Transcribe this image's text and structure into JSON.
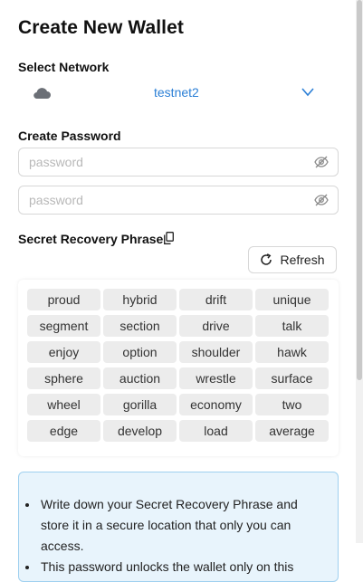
{
  "title": "Create New Wallet",
  "network": {
    "label": "Select Network",
    "selected": "testnet2",
    "icon": "cloud-icon"
  },
  "password": {
    "label": "Create Password",
    "placeholder": "password",
    "confirm_placeholder": "password"
  },
  "recovery": {
    "label": "Secret Recovery Phrase",
    "refresh_label": "Refresh",
    "words": [
      "proud",
      "hybrid",
      "drift",
      "unique",
      "segment",
      "section",
      "drive",
      "talk",
      "enjoy",
      "option",
      "shoulder",
      "hawk",
      "sphere",
      "auction",
      "wrestle",
      "surface",
      "wheel",
      "gorilla",
      "economy",
      "two",
      "edge",
      "develop",
      "load",
      "average"
    ]
  },
  "info": {
    "items": [
      "Write down your Secret Recovery Phrase and store it in a secure location that only you can access.",
      "This password unlocks the wallet only on this"
    ]
  },
  "colors": {
    "accent": "#2b7fd6",
    "info_bg": "#e8f4fc",
    "info_border": "#9fd0ef"
  }
}
